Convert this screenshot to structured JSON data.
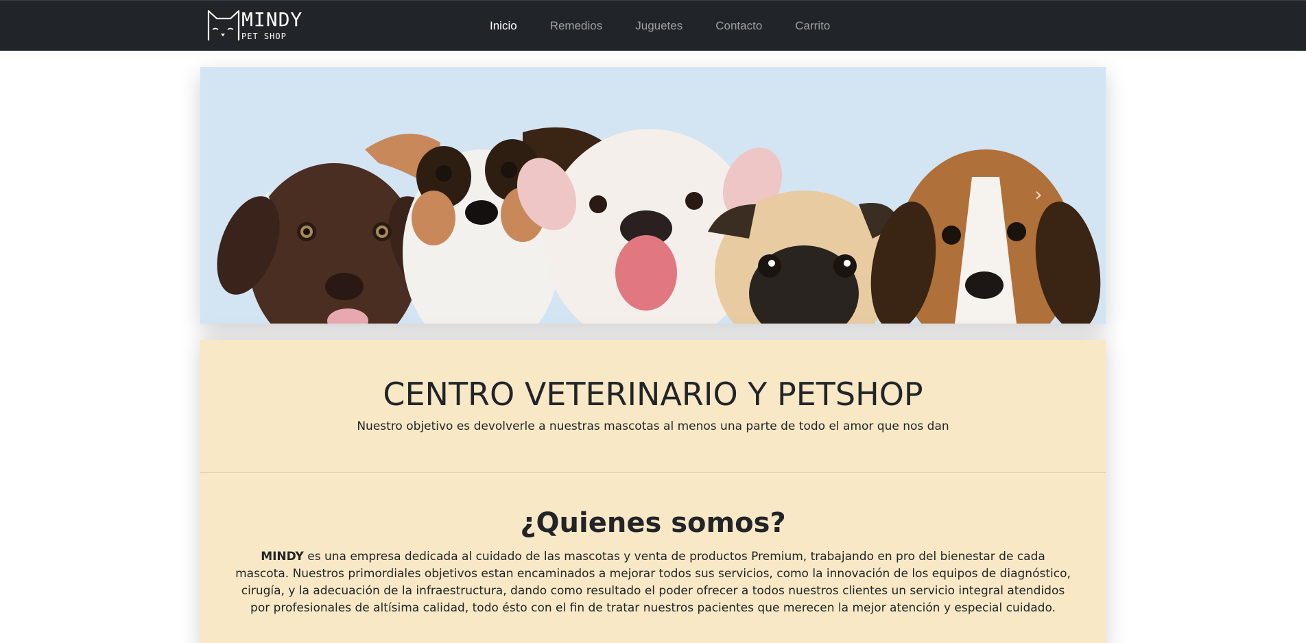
{
  "brand": {
    "name": "MINDY",
    "tagline": "PET SHOP",
    "logo_icon": "cat-ears-logo-icon"
  },
  "nav": {
    "items": [
      {
        "label": "Inicio",
        "active": true
      },
      {
        "label": "Remedios",
        "active": false
      },
      {
        "label": "Juguetes",
        "active": false
      },
      {
        "label": "Contacto",
        "active": false
      },
      {
        "label": "Carrito",
        "active": false
      }
    ]
  },
  "carousel": {
    "prev_icon": "chevron-left-icon",
    "next_icon": "chevron-right-icon",
    "prev_glyph": "‹",
    "next_glyph": "›",
    "image": "five-puppies-banner"
  },
  "hero": {
    "title": "CENTRO VETERINARIO Y PETSHOP",
    "subtitle": "Nuestro objetivo es devolverle a nuestras mascotas al menos una parte de todo el amor que nos dan"
  },
  "about": {
    "title": "¿Quienes somos?",
    "brand_bold": "MINDY",
    "text": " es una empresa dedicada al cuidado de las mascotas y venta de productos Premium, trabajando en pro del bienestar de cada mascota. Nuestros primordiales objetivos estan encaminados a mejorar todos sus servicios, como la innovación de los equipos de diagnóstico, cirugía, y la adecuación de la infraestructura, dando como resultado el poder ofrecer a todos nuestros clientes un servicio integral atendidos por profesionales de altísima calidad, todo ésto con el fin de tratar nuestros pacientes que merecen la mejor atención y especial cuidado."
  },
  "colors": {
    "navbar_bg": "#212529",
    "banner_bg": "#d3e4f3",
    "content_bg": "#f8e8c5",
    "text": "#212529"
  }
}
